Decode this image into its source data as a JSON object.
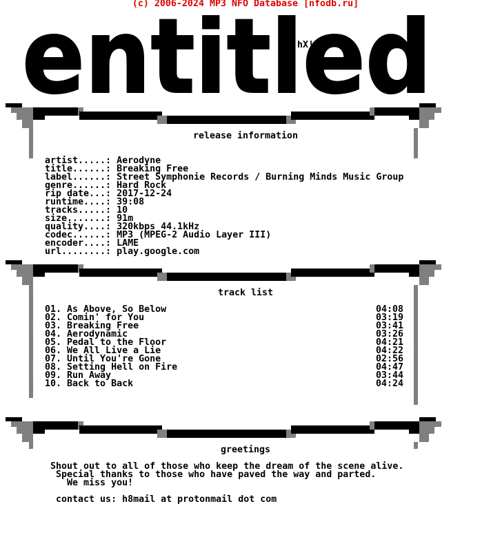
{
  "copyright": "(c) 2006-2024 MP3 NFO Database [nfodb.ru]",
  "logo": {
    "text": "entitled",
    "tag": "hX!"
  },
  "release": {
    "heading": "release information",
    "fields": [
      {
        "key": "artist.....: ",
        "value": "Aerodyne"
      },
      {
        "key": "title......: ",
        "value": "Breaking Free"
      },
      {
        "key": "label......: ",
        "value": "Street Symphonie Records / Burning Minds Music Group"
      },
      {
        "key": "genre......: ",
        "value": "Hard Rock"
      },
      {
        "key": "rip date...: ",
        "value": "2017-12-24"
      },
      {
        "key": "runtime....: ",
        "value": "39:08"
      },
      {
        "key": "tracks.....: ",
        "value": "10"
      },
      {
        "key": "size.......: ",
        "value": "91m"
      },
      {
        "key": "quality....: ",
        "value": "320kbps 44.1kHz"
      },
      {
        "key": "codec......: ",
        "value": "MP3 (MPEG-2 Audio Layer III)"
      },
      {
        "key": "encoder....: ",
        "value": "LAME"
      },
      {
        "key": "url........: ",
        "value": "play.google.com"
      }
    ]
  },
  "tracklist": {
    "heading": "track list",
    "tracks": [
      {
        "title": "01. As Above, So Below",
        "time": "04:08"
      },
      {
        "title": "02. Comin' for You",
        "time": "03:19"
      },
      {
        "title": "03. Breaking Free",
        "time": "03:41"
      },
      {
        "title": "04. Aerodynamic",
        "time": "03:26"
      },
      {
        "title": "05. Pedal to the Floor",
        "time": "04:21"
      },
      {
        "title": "06. We All Live a Lie",
        "time": "04:22"
      },
      {
        "title": "07. Until You're Gone",
        "time": "02:56"
      },
      {
        "title": "08. Setting Hell on Fire",
        "time": "04:47"
      },
      {
        "title": "09. Run Away",
        "time": "03:44"
      },
      {
        "title": "10. Back to Back",
        "time": "04:24"
      }
    ]
  },
  "greetings": {
    "heading": "greetings",
    "lines": [
      " Shout out to all of those who keep the dream of the scene alive.",
      "  Special thanks to those who have paved the way and parted.",
      "    We miss you!"
    ],
    "contact": "  contact us: h8mail at protonmail dot com"
  }
}
